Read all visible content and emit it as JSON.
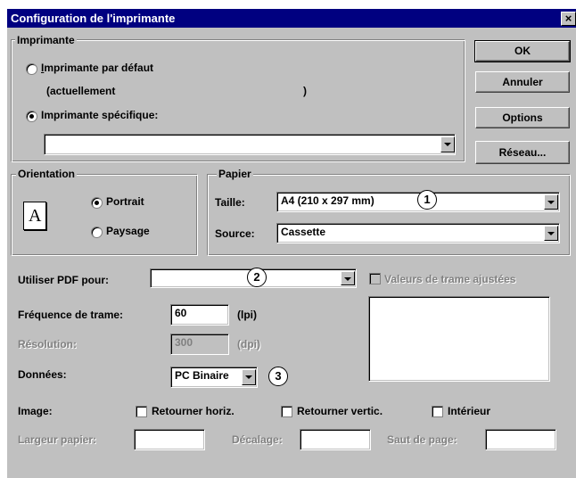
{
  "window": {
    "title": "Configuration de l'imprimante",
    "close_glyph": "×"
  },
  "buttons": {
    "ok": "OK",
    "cancel": "Annuler",
    "options": "Options",
    "network": "Réseau..."
  },
  "printer": {
    "group_label": "Imprimante",
    "default_label": "Imprimante par défaut",
    "current_prefix": "(actuellement",
    "current_suffix": ")",
    "specific_label": "Imprimante spécifique:",
    "selected_printer": "",
    "selected": "specific"
  },
  "orientation": {
    "group_label": "Orientation",
    "icon_glyph": "A",
    "portrait_label": "Portrait",
    "landscape_label": "Paysage",
    "selected": "portrait"
  },
  "paper": {
    "group_label": "Papier",
    "size_label": "Taille:",
    "size_value": "A4 (210 x 297 mm)",
    "source_label": "Source:",
    "source_value": "Cassette"
  },
  "pdf": {
    "label": "Utiliser PDF pour:",
    "value": "",
    "screen_values_label": "Valeurs de trame ajustées",
    "screen_values_checked": false
  },
  "frequency": {
    "label": "Fréquence de trame:",
    "value": "60",
    "unit": "(lpi)"
  },
  "resolution": {
    "label": "Résolution:",
    "value": "300",
    "unit": "(dpi)"
  },
  "data": {
    "label": "Données:",
    "value": "PC Binaire"
  },
  "image": {
    "label": "Image:",
    "flip_h": "Retourner horiz.",
    "flip_v": "Retourner vertic.",
    "inside": "Intérieur"
  },
  "paper_bottom": {
    "width_label": "Largeur papier:",
    "offset_label": "Décalage:",
    "page_jump_label": "Saut de page:"
  },
  "callouts": [
    "1",
    "2",
    "3"
  ]
}
